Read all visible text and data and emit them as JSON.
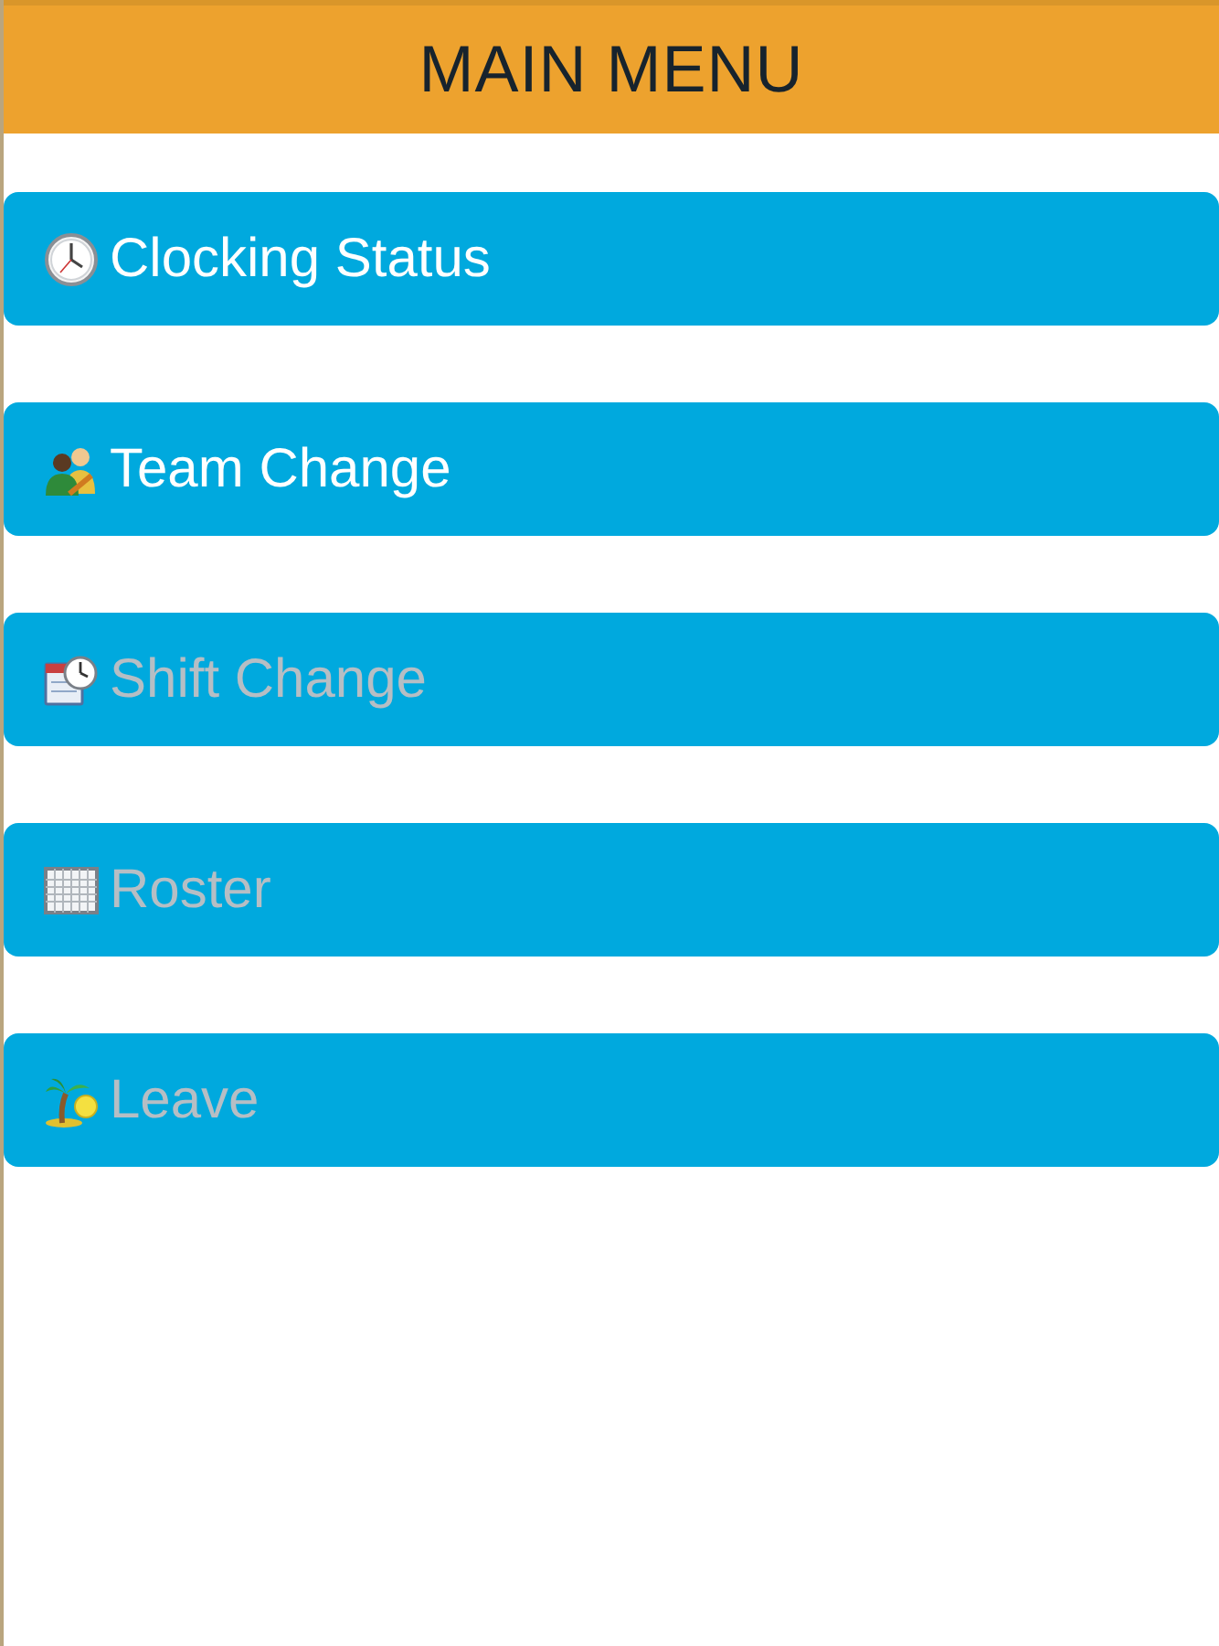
{
  "header": {
    "title": "MAIN MENU"
  },
  "menu": {
    "items": [
      {
        "kind": "clock",
        "label": "Clocking Status",
        "disabled": false
      },
      {
        "kind": "team",
        "label": "Team Change",
        "disabled": false
      },
      {
        "kind": "shift",
        "label": "Shift Change",
        "disabled": true
      },
      {
        "kind": "roster",
        "label": "Roster",
        "disabled": true
      },
      {
        "kind": "leave",
        "label": "Leave",
        "disabled": true
      }
    ]
  }
}
